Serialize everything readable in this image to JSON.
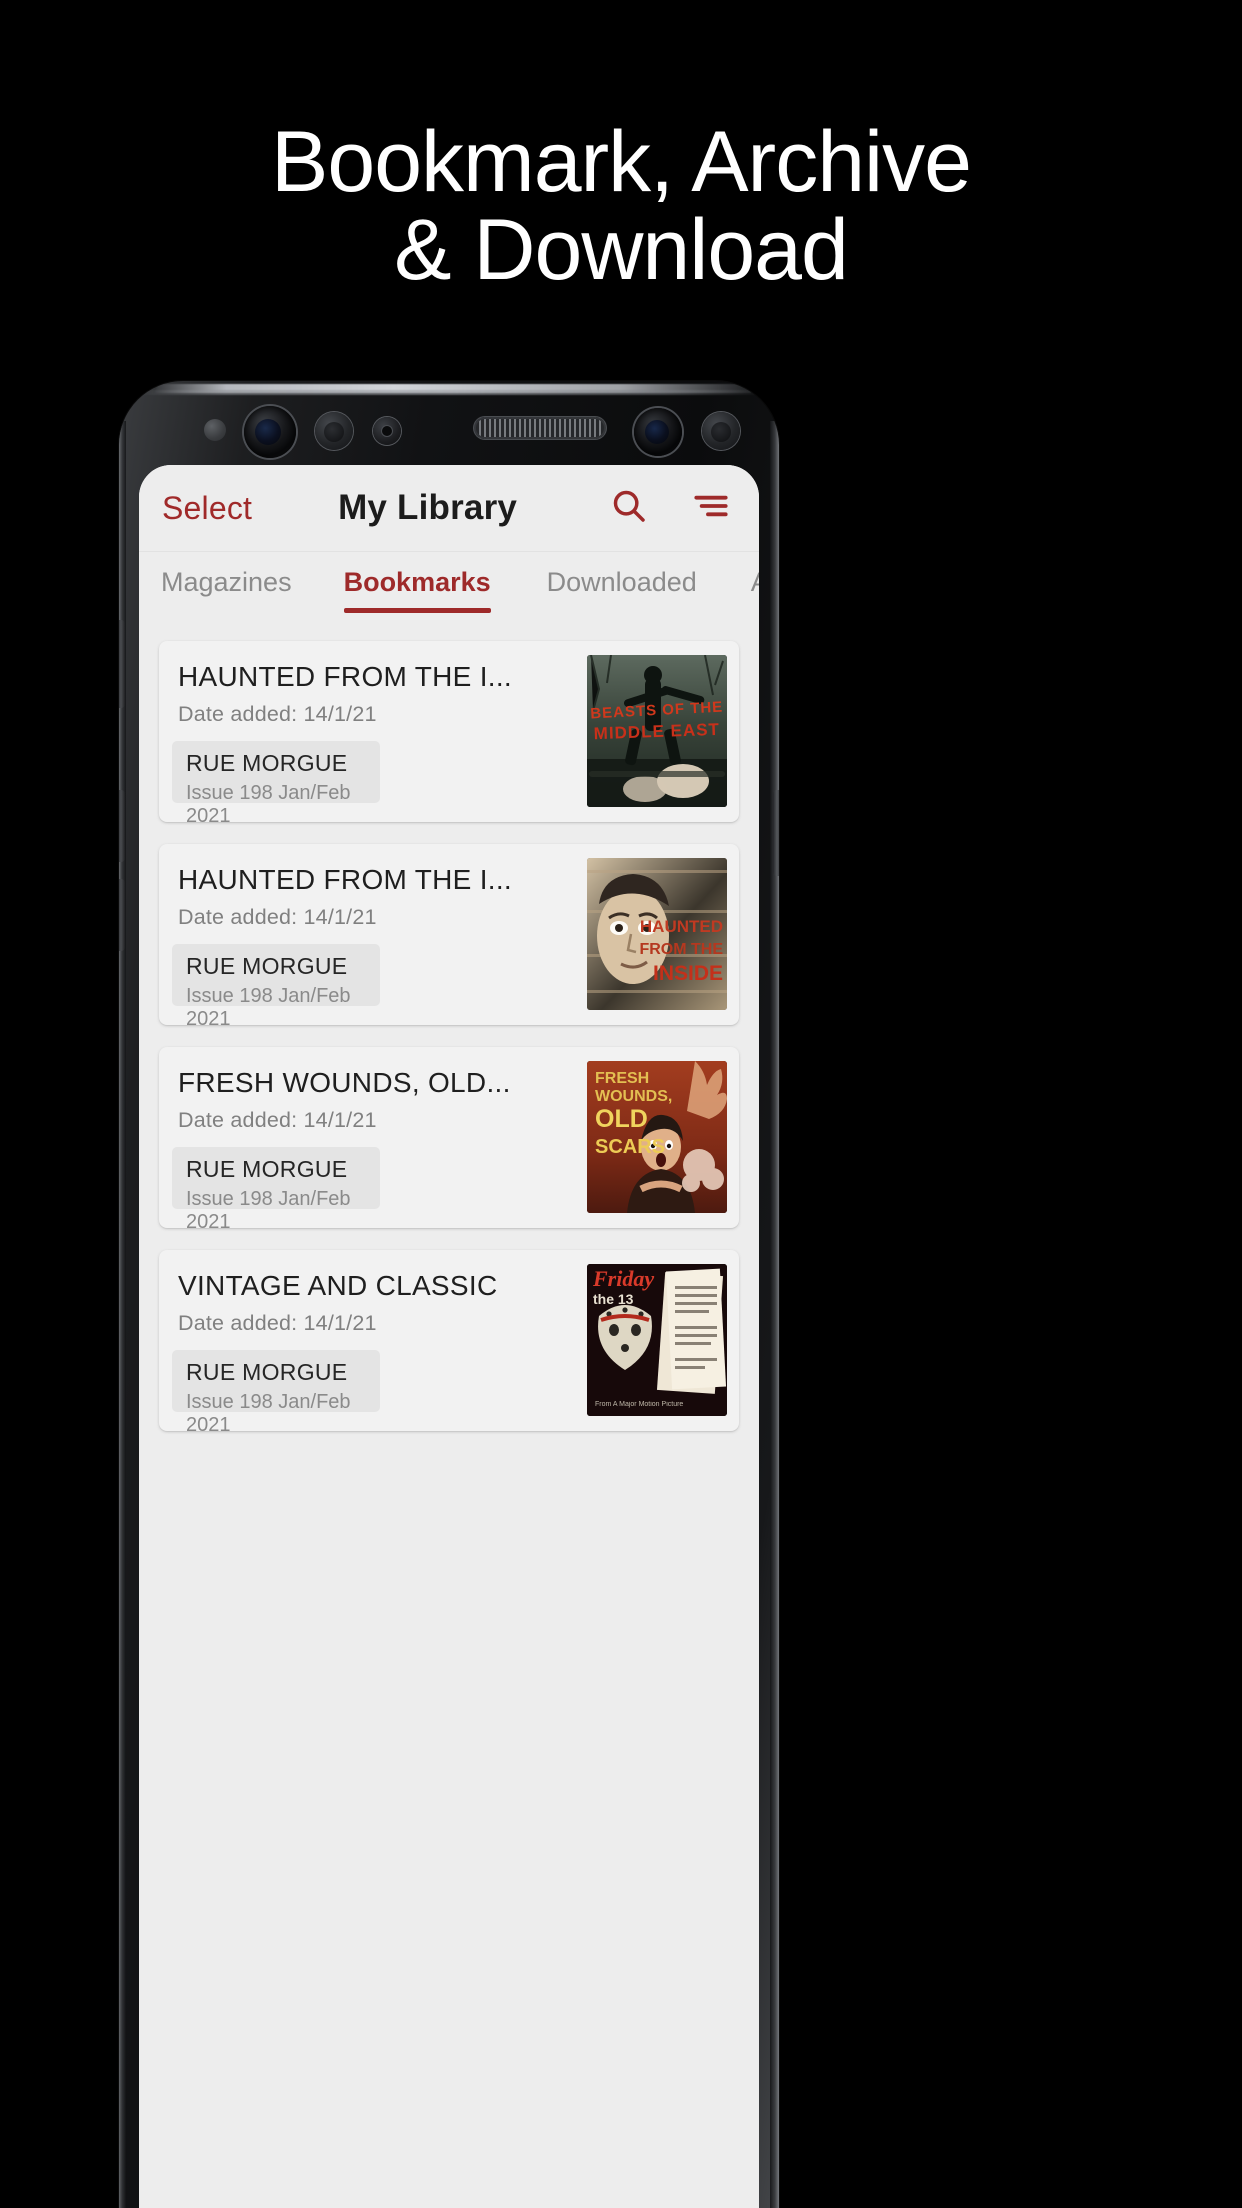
{
  "promo": {
    "headline": "Bookmark, Archive\n& Download",
    "background_color": "#000000",
    "headline_color": "#ffffff"
  },
  "theme": {
    "accent": "#9e2a2a",
    "screen_bg": "#ededed",
    "card_bg": "#f2f2f2",
    "chip_bg": "#e4e4e4",
    "title_color": "#1f1f1f",
    "muted_color": "#808080"
  },
  "appbar": {
    "select_label": "Select",
    "title": "My Library",
    "search_icon": "search-icon",
    "menu_icon": "sort-menu-icon"
  },
  "tabs": [
    {
      "label": "Magazines",
      "active": false
    },
    {
      "label": "Bookmarks",
      "active": true
    },
    {
      "label": "Downloaded",
      "active": false
    },
    {
      "label": "Archived",
      "active": false
    }
  ],
  "cards": [
    {
      "title": "HAUNTED FROM THE I...",
      "date_label": "Date added: 14/1/21",
      "magazine": "RUE MORGUE",
      "issue": "Issue 198 Jan/Feb 2021",
      "cover": {
        "alt": "beasts-of-the-middle-east-cover",
        "line1": "BEASTS OF THE",
        "line2": "MIDDLE EAST",
        "bg": "#2c3a33",
        "text_color": "#c8401f"
      }
    },
    {
      "title": "HAUNTED FROM THE I...",
      "date_label": "Date added: 14/1/21",
      "magazine": "RUE MORGUE",
      "issue": "Issue 198 Jan/Feb 2021",
      "cover": {
        "alt": "haunted-from-the-inside-cover",
        "line1": "HAUNTED",
        "line2": "FROM THE",
        "line3": "INSIDE",
        "bg": "#c9b79a",
        "text_color": "#c03a22"
      }
    },
    {
      "title": "FRESH WOUNDS, OLD...",
      "date_label": "Date added: 14/1/21",
      "magazine": "RUE MORGUE",
      "issue": "Issue 198 Jan/Feb 2021",
      "cover": {
        "alt": "fresh-wounds-old-scars-cover",
        "line1": "FRESH",
        "line2": "WOUNDS,",
        "line3": "OLD",
        "line4": "SCARS",
        "bg": "#8a2f1b",
        "text_color": "#e8c24a"
      }
    },
    {
      "title": "VINTAGE AND CLASSIC",
      "date_label": "Date added: 14/1/21",
      "magazine": "RUE MORGUE",
      "issue": "Issue 198 Jan/Feb 2021",
      "cover": {
        "alt": "friday-the-13th-cover",
        "line1": "Friday",
        "line2": "the 13",
        "bg": "#1b0f10",
        "text_color": "#d93a2a"
      }
    }
  ]
}
